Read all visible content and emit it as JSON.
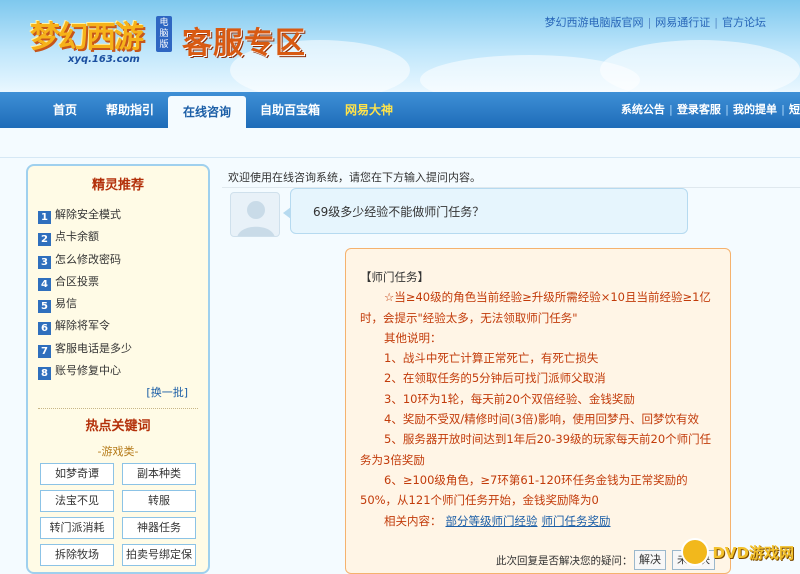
{
  "header": {
    "logo_text": "梦幻西游",
    "logo_badge": "电脑版",
    "logo_url": "xyq.163.com",
    "section_title": "客服专区",
    "top_links": [
      "梦幻西游电脑版官网",
      "网易通行证",
      "官方论坛"
    ]
  },
  "nav": {
    "items": [
      "首页",
      "帮助指引",
      "在线咨询",
      "自助百宝箱",
      "网易大神"
    ],
    "active": "在线咨询",
    "right_links": [
      "系统公告",
      "登录客服",
      "我的提单",
      "短"
    ]
  },
  "sidebar": {
    "title": "精灵推荐",
    "items": [
      {
        "num": "1",
        "label": "解除安全模式"
      },
      {
        "num": "2",
        "label": "点卡余额"
      },
      {
        "num": "3",
        "label": "怎么修改密码"
      },
      {
        "num": "4",
        "label": "合区投票"
      },
      {
        "num": "5",
        "label": "易信"
      },
      {
        "num": "6",
        "label": "解除将军令"
      },
      {
        "num": "7",
        "label": "客服电话是多少"
      },
      {
        "num": "8",
        "label": "账号修复中心"
      }
    ],
    "refresh": "[换一批]",
    "hot_title": "热点关键词",
    "category": "-游戏类-",
    "keywords": [
      "如梦奇谭",
      "副本种类",
      "法宝不见",
      "转服",
      "转门派消耗",
      "神器任务",
      "拆除牧场",
      "拍卖号绑定保"
    ]
  },
  "chat": {
    "welcome": "欢迎使用在线咨询系统，请您在下方输入提问内容。",
    "question": "69级多少经验不能做师门任务？",
    "answer_title": "【师门任务】",
    "answer_intro": "☆当≥40级的角色当前经验≥升级所需经验×10且当前经验≥1亿时，会提示\"经验太多，无法领取师门任务\"",
    "answer_note": "其他说明：",
    "answer_points": [
      "1、战斗中死亡计算正常死亡，有死亡损失",
      "2、在领取任务的5分钟后可找门派师父取消",
      "3、10环为1轮，每天前20个双倍经验、金钱奖励",
      "4、奖励不受双/精修时间(3倍)影响，使用回梦丹、回梦饮有效",
      "5、服务器开放时间达到1年后20-39级的玩家每天前20个师门任务为3倍奖励",
      "6、≥100级角色，≥7环第61-120环任务金钱为正常奖励的50%，从121个师门任务开始，金钱奖励降为0"
    ],
    "related_label": "相关内容：",
    "related_links": [
      "部分等级师门经验",
      "师门任务奖励"
    ],
    "resolve_question": "此次回复是否解决您的疑问：",
    "resolve_yes": "解决",
    "resolve_no": "未解决"
  },
  "watermark": "DVD游戏网"
}
